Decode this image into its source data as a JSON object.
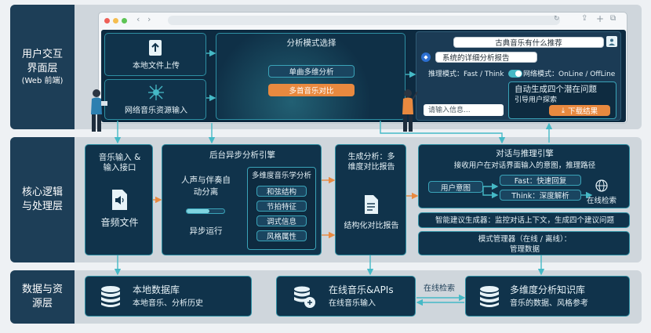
{
  "layers": {
    "ui": {
      "title": "用户交互\n界面层",
      "sub": "(Web 前端)"
    },
    "logic": {
      "title": "核心逻辑\n与处理层"
    },
    "data": {
      "title": "数据与资\n源层"
    }
  },
  "ui": {
    "upload": "本地文件上传",
    "network": "网络音乐资源输入",
    "mode_title": "分析模式选择",
    "mode_single": "单曲多维分析",
    "mode_multi": "多首音乐对比",
    "chat_q": "古典音乐有什么推荐",
    "chat_report": "系统的详细分析报告",
    "infer_mode": "推理模式：Fast / Think",
    "net_mode": "网络模式：OnLine / OffLine",
    "input_placeholder": "请输入信息...",
    "suggest_title": "自动生成四个潜在问题",
    "suggest_sub": "引导用户探索",
    "download": "下载结果"
  },
  "logic": {
    "input_title": "音乐输入 &\n输入接口",
    "audio_file": "音频文件",
    "engine_title": "后台异步分析引擎",
    "separation": "人声与伴奏自\n动分离",
    "async": "异步运行",
    "multi_title": "多维度音乐学分析",
    "chips": [
      "和弦结构",
      "节拍特征",
      "调式信息",
      "风格属性"
    ],
    "gen_title": "生成分析：多\n维度对比报告",
    "gen_report": "结构化对比报告",
    "dialog_title": "对话与推理引擎",
    "dialog_sub": "接收用户在对话界面输入的意图，推理路径",
    "intent": "用户意图",
    "fast": "Fast：快速回复",
    "think": "Think：深度解析",
    "online_search": "在线检索",
    "suggest_gen": "智能建议生成器：监控对话上下文，生成四个建议问题",
    "mode_mgr": "模式管理器（在线 / 离线）：",
    "mode_mgr_sub": "管理数据"
  },
  "data": {
    "local_title": "本地数据库",
    "local_sub": "本地音乐、分析历史",
    "online_title": "在线音乐&APIs",
    "online_sub": "在线音乐输入",
    "search_label": "在线检索",
    "kb_title": "多维度分析知识库",
    "kb_sub": "音乐的数据、风格参考"
  },
  "colors": {
    "navy": "#10334b",
    "teal": "#2e8fa3",
    "orange": "#e8893f"
  }
}
